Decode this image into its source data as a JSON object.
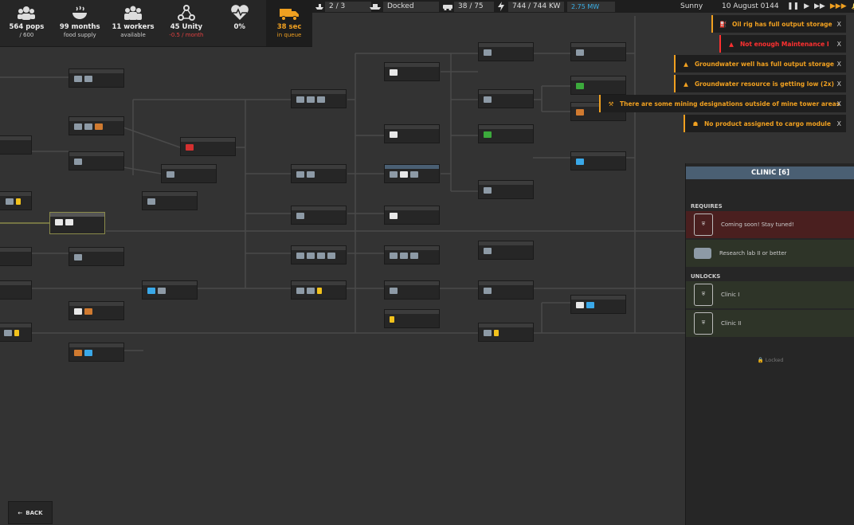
{
  "stats": [
    {
      "value": "564 pops",
      "sub": "/ 600",
      "icon": "people-icon"
    },
    {
      "value": "99 months",
      "sub": "food supply",
      "icon": "food-bowl-icon"
    },
    {
      "value": "11 workers",
      "sub": "available",
      "icon": "workers-icon"
    },
    {
      "value": "45 Unity",
      "sub": "-0.5 / month",
      "icon": "unity-icon"
    },
    {
      "value": "0%",
      "sub": "",
      "icon": "heart-health-icon"
    }
  ],
  "queue": {
    "value": "38 sec",
    "sub": "in queue",
    "icon": "truck-icon"
  },
  "topbar": {
    "ships": "2 / 3",
    "dock_status": "Docked",
    "vehicles": "38 / 75",
    "power": "744 / 744 KW",
    "power_mw": "2.75 MW",
    "weather": "Sunny",
    "date": "10 August 0144"
  },
  "notifications": [
    {
      "text": "Oil rig has full output storage",
      "level": "warning",
      "close": "X"
    },
    {
      "text": "Not enough Maintenance I",
      "level": "error",
      "close": "X"
    },
    {
      "text": "Groundwater well has full output storage",
      "level": "warning",
      "close": "X"
    },
    {
      "text": "Groundwater resource is getting low (2x)",
      "level": "warning",
      "close": "X"
    },
    {
      "text": "There are some mining designations outside of mine tower areas",
      "level": "warning",
      "close": "X"
    },
    {
      "text": "No product assigned to cargo module",
      "level": "warning",
      "close": "X"
    }
  ],
  "panel": {
    "title": "CLINIC [6]",
    "requires_label": "REQUIRES",
    "requires": [
      {
        "text": "Coming soon! Stay tuned!",
        "state": "soon"
      },
      {
        "text": "Research lab II or better",
        "state": "ok"
      }
    ],
    "unlocks_label": "UNLOCKS",
    "unlocks": [
      {
        "text": "Clinic I"
      },
      {
        "text": "Clinic II"
      }
    ],
    "locked_label": "Locked"
  },
  "back_label": "BACK",
  "colors": {
    "accent": "#f0a020",
    "error": "#ff3030",
    "panel_title": "#4a5f73",
    "power_mw": "#3ab0e8"
  }
}
